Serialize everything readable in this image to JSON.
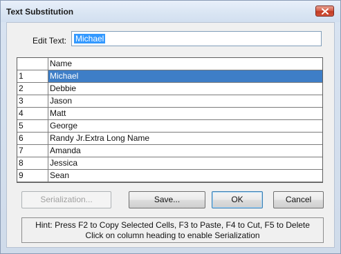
{
  "window": {
    "title": "Text Substitution"
  },
  "edit": {
    "label": "Edit Text:",
    "value": "Michael"
  },
  "grid": {
    "column_header": "Name",
    "rows": [
      {
        "num": "1",
        "name": "Michael",
        "selected": true
      },
      {
        "num": "2",
        "name": "Debbie",
        "selected": false
      },
      {
        "num": "3",
        "name": "Jason",
        "selected": false
      },
      {
        "num": "4",
        "name": "Matt",
        "selected": false
      },
      {
        "num": "5",
        "name": "George",
        "selected": false
      },
      {
        "num": "6",
        "name": "Randy Jr.Extra Long Name",
        "selected": false
      },
      {
        "num": "7",
        "name": "Amanda",
        "selected": false
      },
      {
        "num": "8",
        "name": "Jessica",
        "selected": false
      },
      {
        "num": "9",
        "name": "Sean",
        "selected": false
      }
    ]
  },
  "buttons": {
    "serialization": "Serialization...",
    "save": "Save...",
    "ok": "OK",
    "cancel": "Cancel"
  },
  "hint": {
    "line1": "Hint: Press F2 to Copy Selected Cells, F3 to Paste, F4 to Cut, F5 to Delete",
    "line2": "Click on column heading to enable Serialization"
  },
  "colors": {
    "selection": "#3e7ec7",
    "close_button": "#c23a22"
  }
}
